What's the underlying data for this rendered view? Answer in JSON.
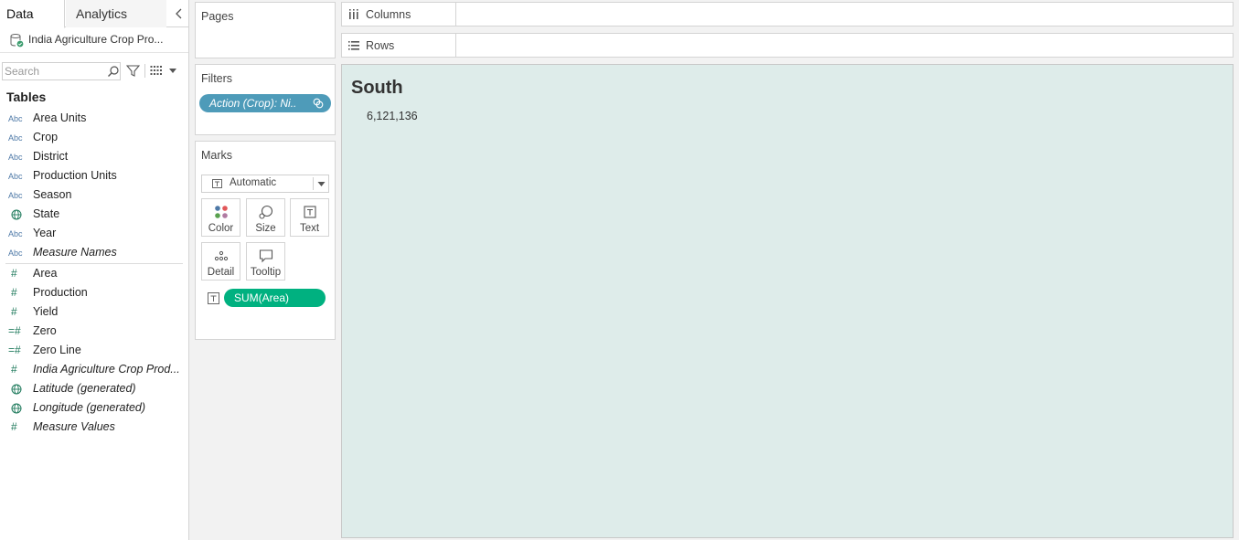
{
  "tabs": {
    "data": "Data",
    "analytics": "Analytics"
  },
  "datasource": {
    "name": "India Agriculture Crop Pro..."
  },
  "search": {
    "placeholder": "Search"
  },
  "tables_heading": "Tables",
  "dimensions": [
    {
      "icon": "Abc",
      "label": "Area Units"
    },
    {
      "icon": "Abc",
      "label": "Crop"
    },
    {
      "icon": "Abc",
      "label": "District"
    },
    {
      "icon": "Abc",
      "label": "Production Units"
    },
    {
      "icon": "Abc",
      "label": "Season"
    },
    {
      "icon": "globe",
      "label": "State"
    },
    {
      "icon": "Abc",
      "label": "Year"
    },
    {
      "icon": "Abc",
      "label": "Measure Names"
    }
  ],
  "measures": [
    {
      "icon": "#",
      "label": "Area"
    },
    {
      "icon": "#",
      "label": "Production"
    },
    {
      "icon": "#",
      "label": "Yield"
    },
    {
      "icon": "=#",
      "label": "Zero"
    },
    {
      "icon": "=#",
      "label": "Zero Line"
    },
    {
      "icon": "#",
      "label": "India Agriculture Crop Prod..."
    },
    {
      "icon": "globe",
      "label": "Latitude (generated)"
    },
    {
      "icon": "globe",
      "label": "Longitude (generated)"
    },
    {
      "icon": "#",
      "label": "Measure Values"
    }
  ],
  "pages": {
    "title": "Pages"
  },
  "filters": {
    "title": "Filters",
    "pill": "Action (Crop): Ni.."
  },
  "marks": {
    "title": "Marks",
    "type": "Automatic",
    "buttons": {
      "color": "Color",
      "size": "Size",
      "text": "Text",
      "detail": "Detail",
      "tooltip": "Tooltip"
    },
    "text_pill": "SUM(Area)"
  },
  "shelves": {
    "columns": "Columns",
    "rows": "Rows"
  },
  "view": {
    "title": "South",
    "value": "6,121,136"
  },
  "colors": {
    "view_bg": "#deecea",
    "filter_pill": "#4e9bb9",
    "measure_pill": "#00b180",
    "dimension_icon": "#4e79a7",
    "measure_icon": "#1f7a5c"
  }
}
